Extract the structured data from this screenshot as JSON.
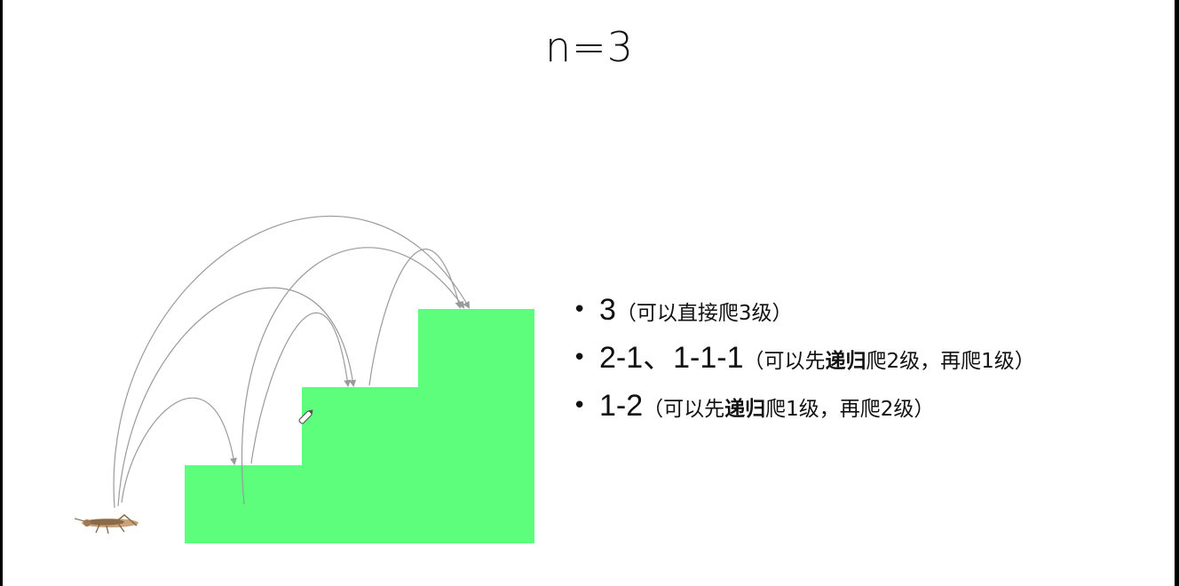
{
  "slide": {
    "title": "n=3",
    "items": [
      {
        "main": "3",
        "note_pre": "（可以直接爬3级）",
        "note_bold": "",
        "note_post": ""
      },
      {
        "main": "2-1、1-1-1",
        "note_pre": "（可以先",
        "note_bold": "递归",
        "note_post": "爬2级，再爬1级）"
      },
      {
        "main": "1-2",
        "note_pre": "（可以先",
        "note_bold": "递归",
        "note_post": "爬1级，再爬2级）"
      }
    ]
  },
  "colors": {
    "stairs": "#5efe7d",
    "arrows": "#9a9a9a",
    "background": "#ffffff"
  },
  "icons": {
    "climber": "grasshopper-icon",
    "cursor": "pen-cursor-icon"
  }
}
